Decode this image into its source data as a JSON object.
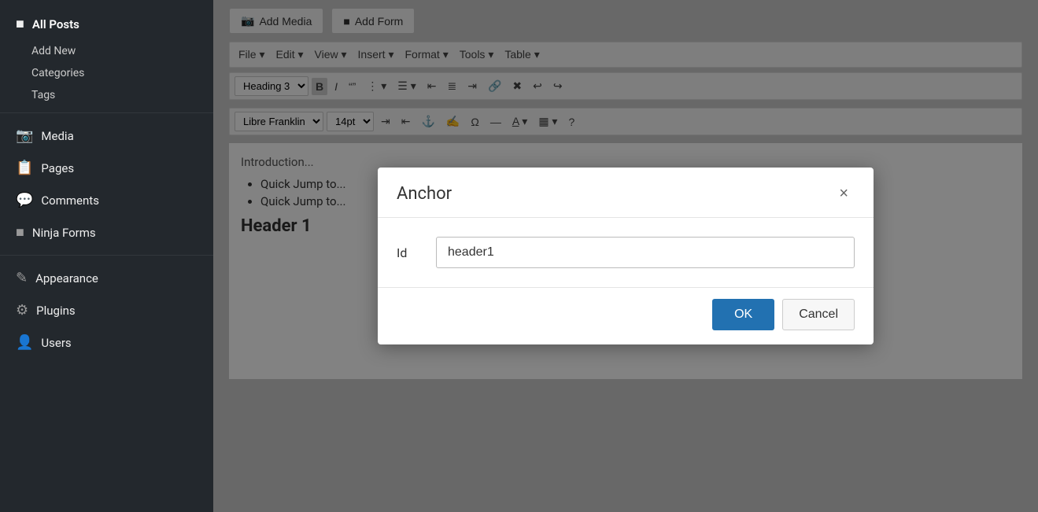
{
  "sidebar": {
    "items": [
      {
        "id": "all-posts",
        "label": "All Posts",
        "icon": "📄",
        "active": true
      },
      {
        "id": "add-new",
        "label": "Add New",
        "icon": "",
        "sub": true
      },
      {
        "id": "categories",
        "label": "Categories",
        "icon": "",
        "sub": true
      },
      {
        "id": "tags",
        "label": "Tags",
        "icon": "",
        "sub": true
      },
      {
        "id": "media",
        "label": "Media",
        "icon": "🖼",
        "active": false
      },
      {
        "id": "pages",
        "label": "Pages",
        "icon": "📋",
        "active": false
      },
      {
        "id": "comments",
        "label": "Comments",
        "icon": "💬",
        "active": false
      },
      {
        "id": "ninja-forms",
        "label": "Ninja Forms",
        "icon": "📝",
        "active": false
      },
      {
        "id": "appearance",
        "label": "Appearance",
        "icon": "🎨",
        "active": false
      },
      {
        "id": "plugins",
        "label": "Plugins",
        "icon": "🔌",
        "active": false
      },
      {
        "id": "users",
        "label": "Users",
        "icon": "👤",
        "active": false
      }
    ]
  },
  "toolbar": {
    "add_media_label": "Add Media",
    "add_form_label": "Add Form",
    "menus": [
      "File",
      "Edit",
      "View",
      "Insert",
      "Format",
      "Tools",
      "Table"
    ],
    "heading_select": "Heading 3",
    "font_select": "Libre Franklin",
    "size_select": "14pt"
  },
  "editor": {
    "intro_text": "Introduction...",
    "list_items": [
      "Quick Jump to...",
      "Quick Jump to..."
    ],
    "header_text": "Header 1"
  },
  "dialog": {
    "title": "Anchor",
    "close_label": "×",
    "field_label": "Id",
    "field_value": "header1",
    "field_placeholder": "",
    "ok_label": "OK",
    "cancel_label": "Cancel"
  }
}
